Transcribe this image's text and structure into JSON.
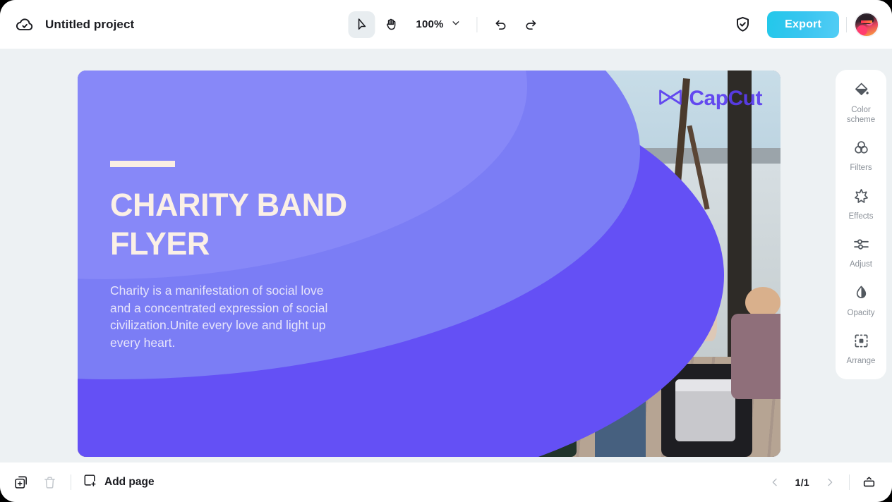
{
  "window": {
    "accent_cyan": "#39c5f0",
    "canvas_bg": "#edf1f3"
  },
  "topbar": {
    "cloud_icon": "cloud-check-icon",
    "project_title": "Untitled project",
    "select_tool": "select-cursor-tool",
    "hand_tool": "hand-tool",
    "zoom_value": "100%",
    "zoom_chevron": "chevron-down-icon",
    "undo": "undo-icon",
    "redo": "redo-icon",
    "shield": "shield-check-icon",
    "export_label": "Export",
    "avatar": "user-avatar"
  },
  "artboard": {
    "bg_purple": "#7b7df5",
    "accent_purple": "#6450f5",
    "rule": "divider-rule",
    "headline": "CHARITY BAND FLYER",
    "body": "Charity is a manifestation of social love and a concentrated expression of social civilization.Unite every love and light up every heart.",
    "watermark_text": "CapCut",
    "watermark_logo": "capcut-logo-icon",
    "photo_alt": "street band performing outdoors"
  },
  "right_panel": {
    "items": [
      {
        "icon": "paint-bucket-icon",
        "label": "Color\nscheme",
        "line1": "Color",
        "line2": "scheme"
      },
      {
        "icon": "filters-circles-icon",
        "label": "Filters",
        "line1": "Filters",
        "line2": ""
      },
      {
        "icon": "sparkle-star-icon",
        "label": "Effects",
        "line1": "Effects",
        "line2": ""
      },
      {
        "icon": "sliders-icon",
        "label": "Adjust",
        "line1": "Adjust",
        "line2": ""
      },
      {
        "icon": "opacity-droplet-icon",
        "label": "Opacity",
        "line1": "Opacity",
        "line2": ""
      },
      {
        "icon": "arrange-frame-icon",
        "label": "Arrange",
        "line1": "Arrange",
        "line2": ""
      }
    ]
  },
  "bottombar": {
    "duplicate_icon": "duplicate-page-icon",
    "delete_icon": "trash-icon",
    "add_page_icon": "add-page-icon",
    "add_page_label": "Add page",
    "prev_icon": "chevron-left-icon",
    "page_indicator": "1/1",
    "next_icon": "chevron-right-icon",
    "expand_icon": "expand-panel-icon"
  }
}
